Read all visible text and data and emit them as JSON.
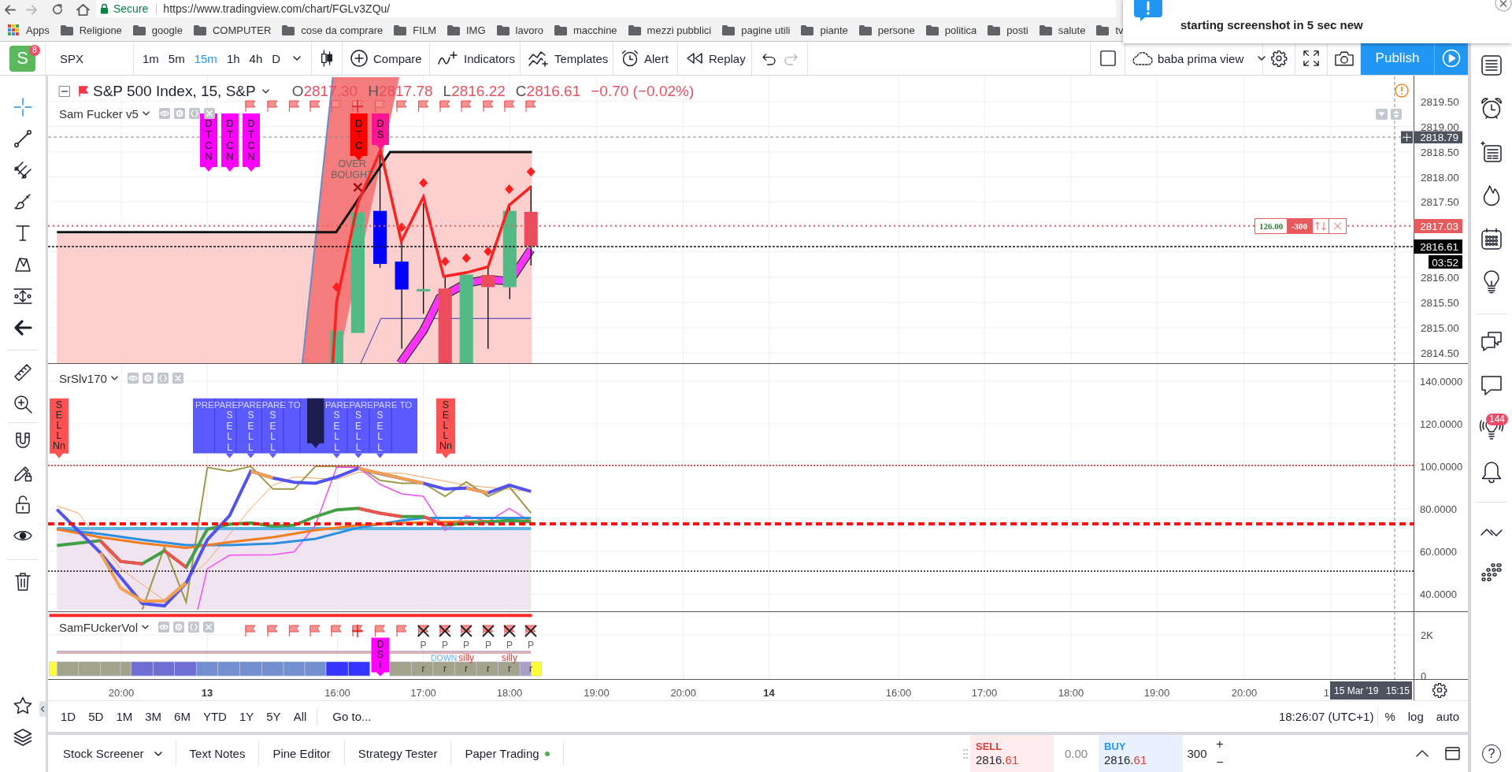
{
  "browser": {
    "secure": "Secure",
    "url": "https://www.tradingview.com/chart/FGLv3ZQu/"
  },
  "bookmarks": [
    {
      "kind": "apps",
      "label": "Apps"
    },
    {
      "kind": "folder",
      "label": "Religione"
    },
    {
      "kind": "folder",
      "label": "google"
    },
    {
      "kind": "folder",
      "label": "COMPUTER"
    },
    {
      "kind": "folder",
      "label": "cose da comprare"
    },
    {
      "kind": "folder",
      "label": "FILM"
    },
    {
      "kind": "folder",
      "label": "IMG"
    },
    {
      "kind": "folder",
      "label": "lavoro"
    },
    {
      "kind": "folder",
      "label": "macchine"
    },
    {
      "kind": "folder",
      "label": "mezzi pubblici"
    },
    {
      "kind": "folder",
      "label": "pagine utili"
    },
    {
      "kind": "folder",
      "label": "piante"
    },
    {
      "kind": "folder",
      "label": "persone"
    },
    {
      "kind": "folder",
      "label": "politica"
    },
    {
      "kind": "folder",
      "label": "posti"
    },
    {
      "kind": "folder",
      "label": "salute"
    },
    {
      "kind": "folder",
      "label": "tv"
    }
  ],
  "notification": {
    "text": "starting screenshot in 5 sec new"
  },
  "toolbar": {
    "logo": "S",
    "logo_badge": "8",
    "symbol": "SPX",
    "intervals": [
      {
        "label": "1m",
        "selected": false
      },
      {
        "label": "5m",
        "selected": false
      },
      {
        "label": "15m",
        "selected": true
      },
      {
        "label": "1h",
        "selected": false
      },
      {
        "label": "4h",
        "selected": false
      },
      {
        "label": "D",
        "selected": false
      }
    ],
    "tools": [
      {
        "kind": "compare",
        "label": "Compare"
      },
      {
        "kind": "indicators",
        "label": "Indicators"
      },
      {
        "kind": "templates",
        "label": "Templates"
      },
      {
        "kind": "alert",
        "label": "Alert"
      },
      {
        "kind": "replay",
        "label": "Replay"
      }
    ],
    "layout": "baba prima view",
    "publish": "Publish"
  },
  "left_toolbar": {
    "groups": [
      [
        {
          "kind": "crosshair",
          "selected": true
        },
        {
          "kind": "trend_line",
          "selected": false
        },
        {
          "kind": "pitchfork",
          "selected": false
        },
        {
          "kind": "brush",
          "selected": false
        },
        {
          "kind": "text",
          "selected": false
        },
        {
          "kind": "pattern",
          "selected": false
        },
        {
          "kind": "measure",
          "selected": false
        },
        {
          "kind": "hide",
          "selected": false
        }
      ],
      [
        {
          "kind": "ruler",
          "selected": false
        },
        {
          "kind": "zoom",
          "selected": false
        }
      ],
      [
        {
          "kind": "magnet",
          "selected": false
        },
        {
          "kind": "lock_drawing",
          "selected": false
        },
        {
          "kind": "lock",
          "selected": false
        },
        {
          "kind": "eye",
          "selected": false
        }
      ],
      [
        {
          "kind": "trash",
          "selected": false
        }
      ]
    ],
    "bottom": [
      {
        "kind": "star"
      },
      {
        "kind": "layers"
      }
    ]
  },
  "chart": {
    "legend": {
      "title": "S&P 500 Index, 15, S&P",
      "ohlc": [
        {
          "key": "O",
          "value": "2817.30"
        },
        {
          "key": "H",
          "value": "2817.78"
        },
        {
          "key": "L",
          "value": "2816.22"
        },
        {
          "key": "C",
          "value": "2816.61"
        }
      ],
      "change": "−0.70 (−0.02%)"
    },
    "indicators": [
      {
        "name": "Sam Fucker v5"
      },
      {
        "name": "SrSlv170"
      },
      {
        "name": "SamFUckerVol"
      }
    ],
    "main_labels": [
      {
        "color": "#ff00ff",
        "lines": [
          "D",
          "T",
          "C",
          "N"
        ]
      },
      {
        "color": "#ff00ff",
        "lines": [
          "D",
          "T",
          "C",
          "N"
        ]
      },
      {
        "color": "#ff00ff",
        "lines": [
          "D",
          "T",
          "C",
          "N"
        ]
      },
      {
        "color": "#ff0000",
        "lines": [
          "D",
          "T",
          "C"
        ]
      },
      {
        "color": "#ff1493",
        "lines": [
          "D",
          "S"
        ]
      }
    ],
    "annotation": {
      "lines": [
        "OVER",
        "BOUGHT"
      ]
    },
    "osc_labels": [
      {
        "kind": "sell",
        "color": "#ff5252",
        "lines": [
          "S",
          "E",
          "L",
          "L",
          "Nn"
        ]
      },
      {
        "kind": "cluster",
        "color": "#5a5aff",
        "headers": [
          "PREPAREPAREPARE TO",
          "PAREPAREPARE TO"
        ],
        "columns": [
          [
            "S",
            "E",
            "L",
            "L"
          ],
          [
            "S",
            "E",
            "L",
            "L"
          ],
          [
            "S",
            "E",
            "L",
            "L"
          ],
          [
            "S",
            "E",
            "L",
            "L"
          ],
          [
            "S",
            "E",
            "L",
            "L"
          ],
          [
            "S",
            "E",
            "L",
            "L"
          ]
        ]
      },
      {
        "kind": "marker",
        "color": "#1c1c50"
      },
      {
        "kind": "sell",
        "color": "#ff5252",
        "lines": [
          "S",
          "E",
          "L",
          "L",
          "Nn"
        ]
      }
    ],
    "vol_marks": {
      "top": [
        "P",
        "P",
        "P",
        "P",
        "P",
        "P"
      ],
      "notes": [
        {
          "text": "DOWN",
          "color": "#5ab4e6"
        },
        {
          "text": "silly",
          "color": "#e53935"
        },
        {
          "text": "silly",
          "color": "#e53935"
        }
      ],
      "bottom": [
        "r",
        "r",
        "r",
        "r",
        "r",
        "r"
      ],
      "label": {
        "color": "#ff00ff",
        "lines": [
          "D",
          "S",
          "i"
        ]
      }
    },
    "price_axis": {
      "labels": [
        "2819.50",
        "2819.00",
        "2818.50",
        "2818.00",
        "2817.50",
        "2816.00",
        "2815.50",
        "2815.00",
        "2814.50"
      ],
      "tags": [
        {
          "kind": "crosshair",
          "text": "2818.79"
        },
        {
          "kind": "order",
          "text": "2817.03"
        },
        {
          "kind": "last",
          "text": "2816.61"
        },
        {
          "kind": "countdown",
          "text": "03:52"
        }
      ]
    },
    "osc_axis": [
      "140.0000",
      "120.0000",
      "100.0000",
      "80.0000",
      "60.0000",
      "40.0000"
    ],
    "vol_axis": [
      "2K",
      "0"
    ],
    "time_axis": {
      "labels": [
        {
          "text": "20:00",
          "bold": false
        },
        {
          "text": "13",
          "bold": true
        },
        {
          "text": "16:00",
          "bold": false
        },
        {
          "text": "17:00",
          "bold": false
        },
        {
          "text": "18:00",
          "bold": false
        },
        {
          "text": "19:00",
          "bold": false
        },
        {
          "text": "20:00",
          "bold": false
        },
        {
          "text": "14",
          "bold": true
        },
        {
          "text": "16:00",
          "bold": false
        },
        {
          "text": "17:00",
          "bold": false
        },
        {
          "text": "18:00",
          "bold": false
        },
        {
          "text": "19:00",
          "bold": false
        },
        {
          "text": "20:00",
          "bold": false
        },
        {
          "text": "1",
          "bold": false
        }
      ],
      "cursor": {
        "date": "15 Mar '19",
        "time": "15:15"
      }
    },
    "order": {
      "price": "126.00",
      "quantity": "-300"
    }
  },
  "range_bar": {
    "ranges": [
      "1D",
      "5D",
      "1M",
      "3M",
      "6M",
      "YTD",
      "1Y",
      "5Y",
      "All"
    ],
    "goto": "Go to...",
    "clock": "18:26:07 (UTC+1)",
    "scales": [
      "%",
      "log",
      "auto"
    ]
  },
  "bottom_panel": {
    "tabs": [
      {
        "kind": "menu",
        "label": "Stock Screener"
      },
      {
        "kind": "plain",
        "label": "Text Notes"
      },
      {
        "kind": "plain",
        "label": "Pine Editor"
      },
      {
        "kind": "plain",
        "label": "Strategy Tester"
      },
      {
        "kind": "status",
        "label": "Paper Trading"
      }
    ],
    "connected": true,
    "sell": {
      "label": "SELL",
      "price": "2816.",
      "pips": "61"
    },
    "spread": "0.00",
    "buy": {
      "label": "BUY",
      "price": "2816.",
      "pips": "61"
    },
    "quantity": "300",
    "steppers": [
      "+",
      "−"
    ]
  },
  "right_sidebar": {
    "groups": [
      [
        {
          "kind": "list"
        },
        {
          "kind": "alarm"
        },
        {
          "kind": "news"
        },
        {
          "kind": "hotlist"
        },
        {
          "kind": "calendar"
        },
        {
          "kind": "idea"
        }
      ],
      [
        {
          "kind": "chats"
        },
        {
          "kind": "chat"
        },
        {
          "kind": "streams",
          "badge": "144"
        },
        {
          "kind": "bell"
        }
      ],
      [
        {
          "kind": "chevrons"
        },
        {
          "kind": "dots"
        }
      ]
    ],
    "help": "?"
  }
}
